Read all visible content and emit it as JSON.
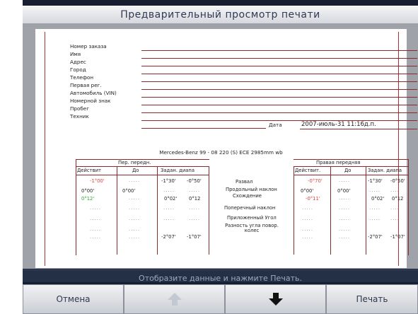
{
  "title": "Предварительный просмотр печати",
  "form": {
    "fields": [
      "Номер заказа",
      "Имя",
      "Адрес",
      "Город",
      "Телефон",
      "Первая рег.",
      "Автомобиль (VIN)",
      "Номерной знак",
      "Пробег",
      "Техник"
    ],
    "date_label": "Дата",
    "date_value": "2007-июль-31 11:16д.п."
  },
  "vehicle": "Mercedes-Benz 99 - 08 220 (S) ECE 2985mm wb",
  "table": {
    "front_header": "Пер. передн.",
    "rear_header": "Правая передняя",
    "col_actual": "Действит",
    "col_actual_rear": "Действит.",
    "col_to": "До",
    "col_spec": "Задан. диапа",
    "rows": [
      "Развал",
      "Продольный наклон",
      "Схождение",
      "Поперечный наклон",
      "Приложенный Угол",
      "Разность угла повор. колес"
    ],
    "left": {
      "actual": [
        "-1°00'",
        "0°00'",
        "0°12'"
      ],
      "before": [
        "0°00'"
      ],
      "spec_min": [
        "-1°30'",
        "0°02'",
        "-2°07'"
      ],
      "spec_max": [
        "-0°50'",
        "0°12",
        "-1°07'"
      ]
    },
    "right": {
      "actual": [
        "-0°70'",
        "0°00'",
        "-0°11'"
      ],
      "before": [
        "0°00'"
      ],
      "spec_min": [
        "-1°30'",
        "0°02'",
        "-2°07'"
      ],
      "spec_max": [
        "-0°50'",
        "0°12",
        "-1°07'"
      ]
    }
  },
  "status": "Отобразите данные и нажмите Печать.",
  "buttons": {
    "cancel": "Отмена",
    "print": "Печать"
  },
  "icons": [
    "arrow-up-icon",
    "arrow-down-icon"
  ]
}
